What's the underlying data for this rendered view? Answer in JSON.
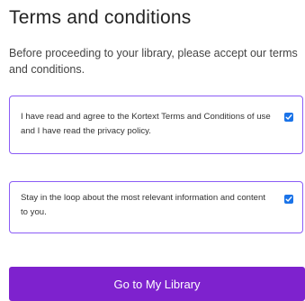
{
  "header": {
    "title": "Terms and conditions"
  },
  "intro": {
    "text": "Before proceeding to your library, please accept our terms and conditions."
  },
  "consents": [
    {
      "label": "I have read and agree to the Kortext Terms and Conditions of use and I have read the privacy policy.",
      "checked": true
    },
    {
      "label": "Stay in the loop about the most relevant information and content to you.",
      "checked": true
    }
  ],
  "actions": {
    "primary_label": "Go to My Library"
  },
  "colors": {
    "accent": "#7e22ce",
    "card_border": "#8b5cf6",
    "checkbox": "#1a73e8"
  },
  "icons": {
    "checkbox": "check-icon"
  }
}
